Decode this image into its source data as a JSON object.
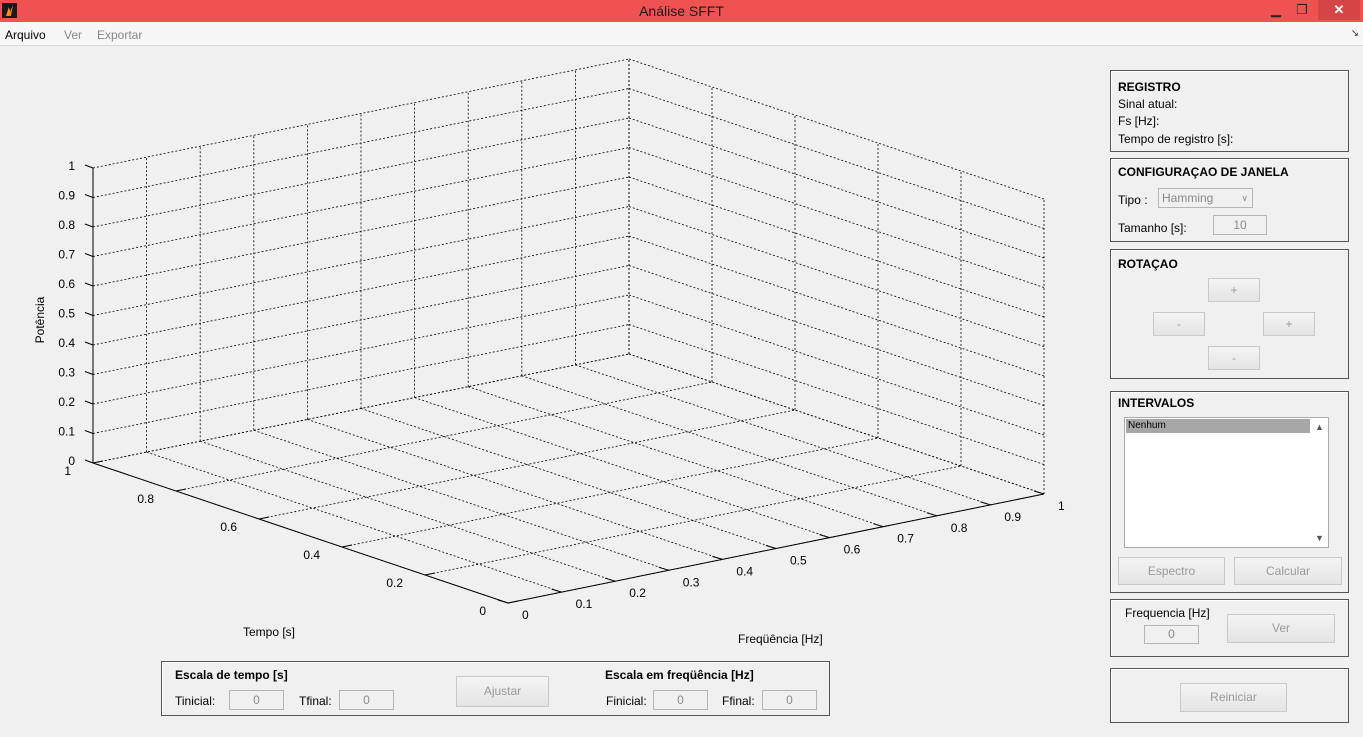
{
  "window": {
    "title": "Análise SFFT",
    "minimize": "▁",
    "maximize": "❐",
    "close": "✕"
  },
  "menu": {
    "arquivo": "Arquivo",
    "ver": "Ver",
    "exportar": "Exportar",
    "dock": "↘"
  },
  "plot": {
    "zlabel": "Potência",
    "ylabel": "Tempo [s]",
    "xlabel": "Freqüência [Hz]",
    "z_ticks": [
      "0",
      "0.1",
      "0.2",
      "0.3",
      "0.4",
      "0.5",
      "0.6",
      "0.7",
      "0.8",
      "0.9",
      "1"
    ],
    "y_ticks": [
      "0",
      "0.2",
      "0.4",
      "0.6",
      "0.8",
      "1"
    ],
    "x_ticks": [
      "0",
      "0.1",
      "0.2",
      "0.3",
      "0.4",
      "0.5",
      "0.6",
      "0.7",
      "0.8",
      "0.9",
      "1"
    ]
  },
  "registro": {
    "title": "REGISTRO",
    "sinal_atual": "Sinal atual:",
    "fs": "Fs [Hz]:",
    "tempo_registro": "Tempo de registro [s]:"
  },
  "janela": {
    "title": "CONFIGURAÇAO DE JANELA",
    "tipo_label": "Tipo :",
    "tipo_value": "Hamming",
    "tamanho_label": "Tamanho [s]:",
    "tamanho_value": "10"
  },
  "rotacao": {
    "title": "ROTAÇAO",
    "up": "+",
    "left": "-",
    "right": "+",
    "down": "-"
  },
  "intervalos": {
    "title": "INTERVALOS",
    "items": [
      "Nenhum"
    ],
    "espectro": "Espectro",
    "calcular": "Calcular",
    "scroll_up": "▲",
    "scroll_down": "▼"
  },
  "frequencia": {
    "label": "Frequencia [Hz]",
    "value": "0",
    "ver": "Ver"
  },
  "reiniciar": {
    "label": "Reiniciar"
  },
  "escalas": {
    "tempo_title": "Escala de tempo [s]",
    "tinicial_label": "Tinicial:",
    "tinicial_value": "0",
    "tfinal_label": "Tfinal:",
    "tfinal_value": "0",
    "ajustar": "Ajustar",
    "freq_title": "Escala em freqüência [Hz]",
    "finicial_label": "Finicial:",
    "finicial_value": "0",
    "ffinal_label": "Ffinal:",
    "ffinal_value": "0"
  }
}
